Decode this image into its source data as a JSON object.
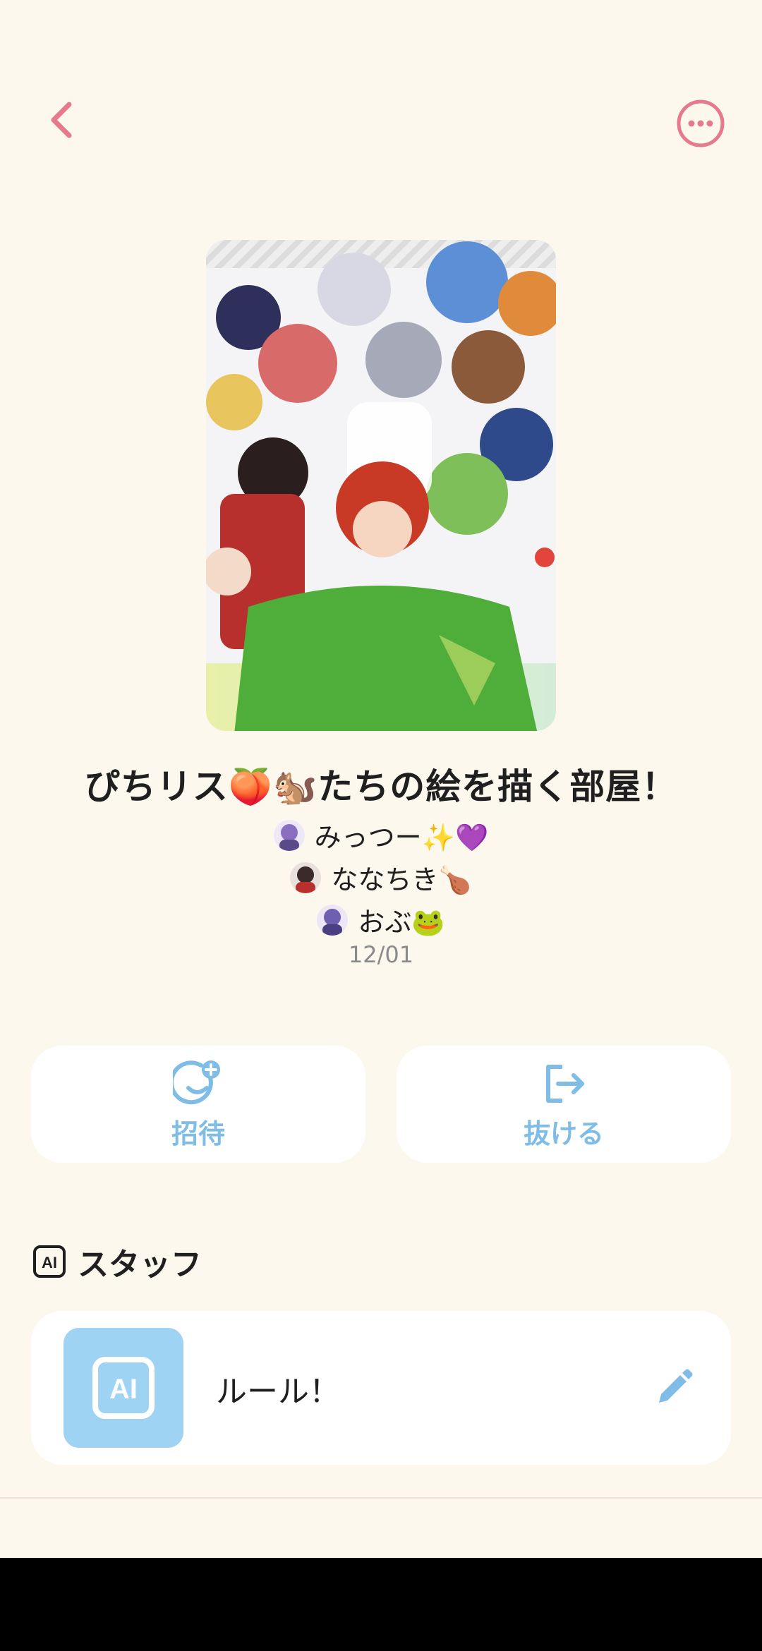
{
  "header": {
    "back_icon": "chevron-left-icon",
    "more_icon": "more-circle-icon",
    "accent_color": "#e57a8d"
  },
  "room": {
    "title": "ぴちリス🍑🐿️たちの絵を描く部屋！",
    "members": [
      {
        "name": "みっつー✨💜",
        "avatar_color": "#8a6fc0"
      },
      {
        "name": "ななちき🍗",
        "avatar_color": "#3a2a2a"
      },
      {
        "name": "おぶ🐸",
        "avatar_color": "#6f5fb0"
      }
    ],
    "date": "12/01"
  },
  "actions": {
    "invite_label": "招待",
    "leave_label": "抜ける",
    "color": "#7fbde6"
  },
  "staff_section": {
    "title": "スタッフ",
    "badge": "AI",
    "items": [
      {
        "name": "ルール！",
        "badge": "AI"
      }
    ]
  }
}
